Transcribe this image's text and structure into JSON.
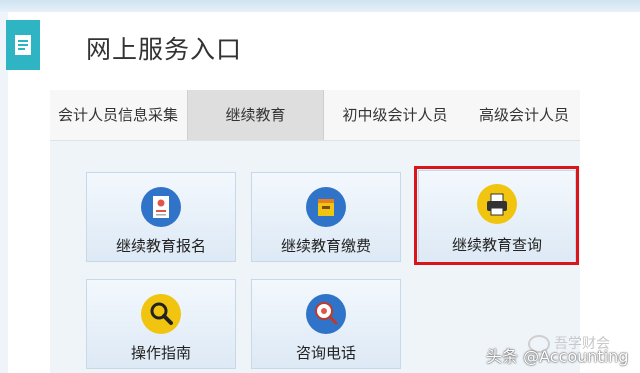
{
  "header": {
    "title": "网上服务入口"
  },
  "tabs": [
    {
      "label": "会计人员信息采集",
      "active": false
    },
    {
      "label": "继续教育",
      "active": true
    },
    {
      "label": "初中级会计人员",
      "active": false
    },
    {
      "label": "高级会计人员",
      "active": false
    }
  ],
  "tiles": [
    {
      "label": "继续教育报名",
      "icon": "registration-form-icon"
    },
    {
      "label": "继续教育缴费",
      "icon": "payment-box-icon"
    },
    {
      "label": "继续教育查询",
      "icon": "printer-icon"
    },
    {
      "label": "操作指南",
      "icon": "magnifier-icon"
    },
    {
      "label": "咨询电话",
      "icon": "consult-search-icon"
    }
  ],
  "watermarks": {
    "wechat": "吾学财会",
    "toutiao": "头条 @Accounting"
  },
  "colors": {
    "accent_teal": "#2fb4c4",
    "highlight_red": "#d9141b",
    "tile_icon_blue": "#2f74c9",
    "tile_icon_yellow": "#f1c40f"
  }
}
